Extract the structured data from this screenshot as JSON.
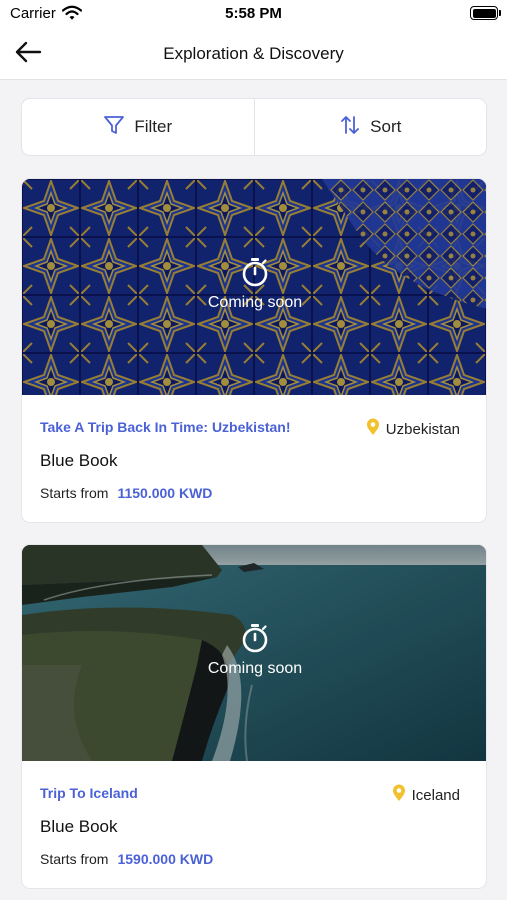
{
  "status_bar": {
    "carrier": "Carrier",
    "time": "5:58 PM"
  },
  "header": {
    "title": "Exploration & Discovery",
    "back_icon": "arrow-left-icon"
  },
  "toolbar": {
    "filter_label": "Filter",
    "sort_label": "Sort",
    "filter_icon": "funnel-icon",
    "sort_icon": "sort-arrows-icon"
  },
  "trips": [
    {
      "image": "blue-mosaic-tiles",
      "badge": "Coming soon",
      "badge_icon": "stopwatch-icon",
      "title": "Take A Trip Back In Time: Uzbekistan!",
      "location": "Uzbekistan",
      "location_icon": "map-pin-icon",
      "book": "Blue Book",
      "price_label": "Starts from",
      "price": "1150.000 KWD"
    },
    {
      "image": "iceland-coastline",
      "badge": "Coming soon",
      "badge_icon": "stopwatch-icon",
      "title": "Trip To Iceland",
      "location": "Iceland",
      "location_icon": "map-pin-icon",
      "book": "Blue Book",
      "price_label": "Starts from",
      "price": "1590.000 KWD"
    }
  ],
  "colors": {
    "accent": "#4b62d6",
    "pin": "#f2c12e",
    "background": "#f3f3f5"
  }
}
